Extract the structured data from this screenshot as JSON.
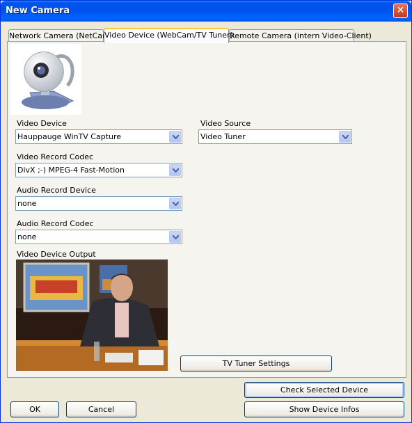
{
  "window": {
    "title": "New Camera"
  },
  "tabs": [
    {
      "label": "Network Camera (NetCam)"
    },
    {
      "label": "Video Device (WebCam/TV Tuner)"
    },
    {
      "label": "Remote Camera (intern Video-Client)"
    }
  ],
  "icons": {
    "camera": "webcam-image",
    "close": "close-icon",
    "dropdown": "chevron-down-icon"
  },
  "form": {
    "video_device": {
      "label": "Video Device",
      "value": "Hauppauge WinTV Capture"
    },
    "video_source": {
      "label": "Video Source",
      "value": "Video Tuner"
    },
    "video_codec": {
      "label": "Video Record Codec",
      "value": "DivX ;-) MPEG-4 Fast-Motion"
    },
    "audio_device": {
      "label": "Audio Record Device",
      "value": "none"
    },
    "audio_codec": {
      "label": "Audio Record Codec",
      "value": "none"
    },
    "preview": {
      "label": "Video Device Output"
    }
  },
  "buttons": {
    "tuner_settings": "TV Tuner Settings",
    "check_device": "Check Selected Device",
    "show_infos": "Show Device Infos",
    "ok": "OK",
    "cancel": "Cancel"
  },
  "colors": {
    "titlebar": "#0054e3",
    "tab_highlight": "#ffc83c",
    "dialog_bg": "#ece9d8",
    "panel_bg": "#f5f4ef"
  }
}
